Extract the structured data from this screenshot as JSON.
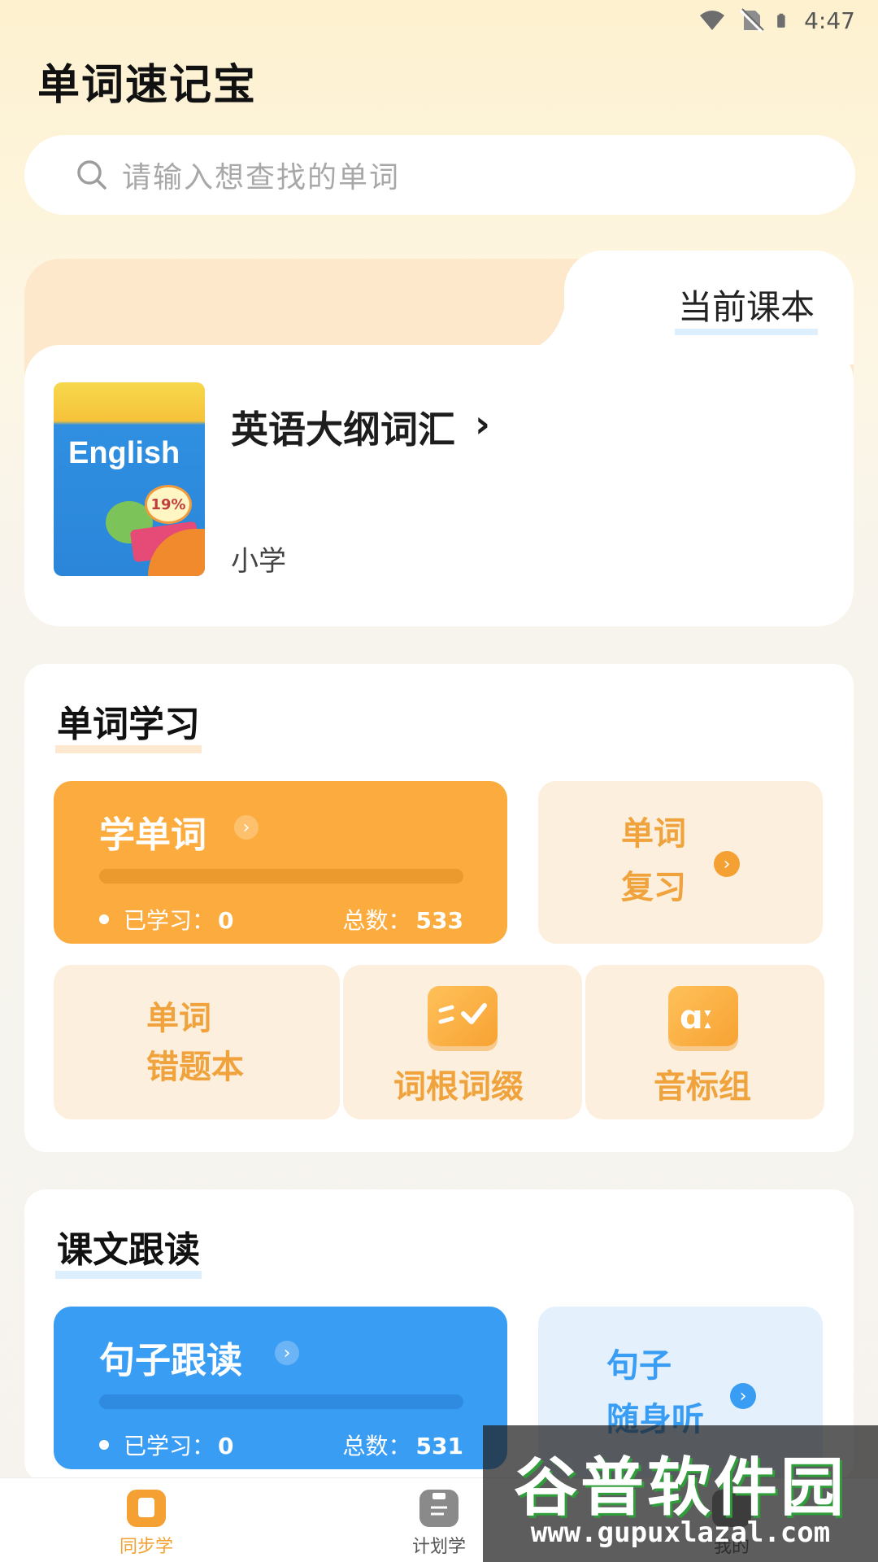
{
  "status_bar": {
    "time": "4:47"
  },
  "app": {
    "title": "单词速记宝"
  },
  "search": {
    "placeholder": "请输入想查找的单词"
  },
  "current_book": {
    "tab_label": "当前课本",
    "cover_word": "English",
    "cover_badge": "19%",
    "title": "英语大纲词汇",
    "chevron": "›",
    "level": "小学"
  },
  "word_study": {
    "title": "单词学习",
    "learn_tile": {
      "title": "学单词",
      "arrow": "›",
      "progress": 0,
      "learned_label": "已学习：",
      "learned_value": "0",
      "total_label": "总数：",
      "total_value": "533"
    },
    "review_tile": {
      "line1": "单词",
      "line2": "复习",
      "arrow": "›"
    },
    "mistakes_tile": {
      "line1": "单词",
      "line2": "错题本"
    },
    "roots_tile": {
      "label": "词根词缀"
    },
    "phonetic_tile": {
      "label": "音标组"
    }
  },
  "text_follow": {
    "title": "课文跟读",
    "sentence_tile": {
      "title": "句子跟读",
      "arrow": "›",
      "progress": 0,
      "learned_label": "已学习：",
      "learned_value": "0",
      "total_label": "总数：",
      "total_value": "531"
    },
    "listen_tile": {
      "line1": "句子",
      "line2": "随身听",
      "arrow": "›"
    }
  },
  "bottom_nav": {
    "items": [
      {
        "label": "同步学",
        "active": true
      },
      {
        "label": "计划学",
        "active": false
      },
      {
        "label": "我的",
        "active": false
      }
    ]
  },
  "watermark": {
    "title": "谷普软件园",
    "url": "www.gupuxlazal.com"
  },
  "colors": {
    "orange": "#fcac3e",
    "blue": "#3a9df4",
    "nav_active": "#f5a033",
    "nav_inactive": "#8a8a8a"
  }
}
